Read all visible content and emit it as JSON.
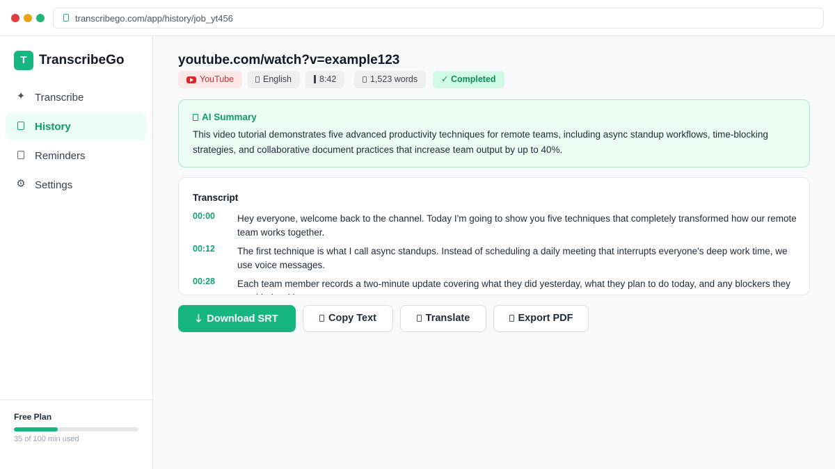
{
  "browser": {
    "url": "transcribego.com/app/history/job_yt456"
  },
  "sidebar": {
    "logo_letter": "T",
    "brand": "TranscribeGo",
    "items": [
      {
        "label": "Transcribe",
        "icon": "sparkle-icon",
        "active": false
      },
      {
        "label": "History",
        "icon": "history-icon",
        "active": true
      },
      {
        "label": "Reminders",
        "icon": "bell-icon",
        "active": false
      },
      {
        "label": "Settings",
        "icon": "gear-icon",
        "active": false
      }
    ],
    "plan": {
      "title": "Free Plan",
      "usage_text": "35 of 100 min used",
      "used_fraction": 0.35
    }
  },
  "job": {
    "title": "youtube.com/watch?v=example123",
    "tags": {
      "source": "YouTube",
      "language": "English",
      "duration": "8:42",
      "words": "1,523 words",
      "status": "✓ Completed"
    }
  },
  "summary": {
    "heading": "AI Summary",
    "text": "This video tutorial demonstrates five advanced productivity techniques for remote teams, including async standup workflows, time-blocking strategies, and collaborative document practices that increase team output by up to 40%."
  },
  "transcript": {
    "heading": "Transcript",
    "segments": [
      {
        "time": "00:00",
        "text": "Hey everyone, welcome back to the channel. Today I'm going to show you five techniques that completely transformed how our remote team works together."
      },
      {
        "time": "00:12",
        "text": "The first technique is what I call async standups. Instead of scheduling a daily meeting that interrupts everyone's deep work time, we use voice messages."
      },
      {
        "time": "00:28",
        "text": "Each team member records a two-minute update covering what they did yesterday, what they plan to do today, and any blockers they need help with."
      }
    ]
  },
  "actions": {
    "download": "Download SRT",
    "copy": "Copy Text",
    "translate": "Translate",
    "export": "Export PDF"
  },
  "colors": {
    "accent": "#17b57f",
    "accent_text": "#0f9a6b",
    "youtube": "#e02424"
  }
}
